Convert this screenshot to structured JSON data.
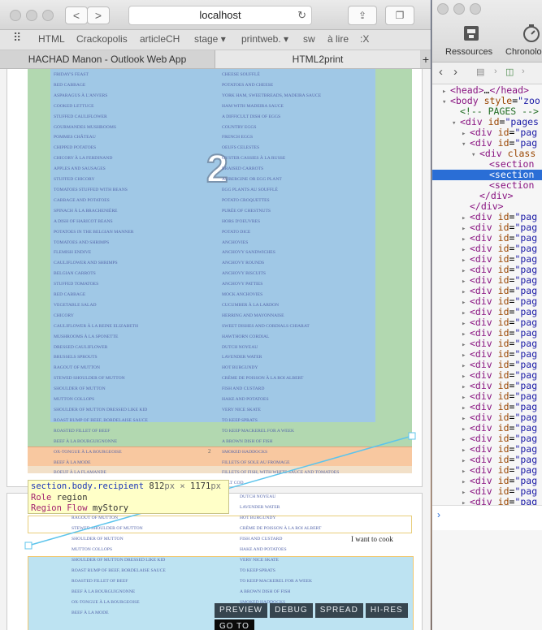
{
  "browser": {
    "url": "localhost",
    "nav": {
      "back": "<",
      "forward": ">"
    },
    "bookmarks": [
      "HTML",
      "Crackopolis",
      "articleCH",
      "stage ▾",
      "printweb. ▾",
      "sw",
      "à lire",
      ":X"
    ],
    "tabs": [
      "HACHAD Manon - Outlook Web App",
      "HTML2print"
    ],
    "new_tab": "+"
  },
  "page1": {
    "big_number": "2",
    "page_number": "2",
    "col1": [
      "Friday's feast",
      "Red cabbage",
      "Asparagus à l'anvers",
      "Cooked lettuce",
      "Stuffed cauliflower",
      "Gourmandes mushrooms",
      "Pommes château",
      "Chipped potatoes",
      "Chicory à la ferdinand",
      "Apples and sausages",
      "Stuffed chicory",
      "Tomatoes stuffed with beans",
      "Cabbage and potatoes",
      "Spinach à la brachenière",
      "A dish of haricot beans",
      "Potatoes in the belgian manner",
      "Tomatoes and shrimps",
      "Flemish endive",
      "Cauliflower and shrimps",
      "Belgian carrots",
      "Stuffed tomatoes",
      "Red cabbage",
      "Vegetable salad",
      "Chicory",
      "Cauliflower à la reine elizabeth",
      "Mushrooms à la sponette",
      "Dressed cauliflower",
      "Brussels sprouts",
      "Ragout of mutton",
      "Stewed shoulder of mutton",
      "Shoulder of mutton",
      "Mutton collops",
      "Shoulder of mutton dressed like kid",
      "Roast rump of beef, bordelaise sauce",
      "Roasted fillet of beef",
      "Beef à la bourguignonne",
      "Ox-tongue à la bourgeoise",
      "Beef à la mode",
      "Boeuf à la flamande"
    ],
    "col2": [
      "Cheese soufflé",
      "Potatoes and cheese",
      "York ham, sweetbreads, madeira sauce",
      "Ham with madeira sauce",
      "A difficult dish of eggs",
      "Country eggs",
      "French eggs",
      "Oeufs celestes",
      "Oyster cassies à la russe",
      "Braised carrots",
      "Aubergine or egg plant",
      "Egg plants au soufflé",
      "Potato croquettes",
      "Purée of chestnuts",
      "Hors d'oeuvres",
      "Potato dice",
      "Anchovies",
      "Anchovy sandwiches",
      "Anchovy rounds",
      "Anchovy biscuits",
      "Anchovy patties",
      "Mock anchovies",
      "Cucumber à la lardon",
      "Herring and mayonnaise",
      "Sweet dishes and cordials chiarat",
      "Hawthorn cordial",
      "Dutch noyeau",
      "Lavender water",
      "Hot burgundy",
      "Crème de poisson à la roi albert",
      "Fish and custard",
      "Hake and potatoes",
      "Very nice skate",
      "To keep sprats",
      "To keep mackerel for a week",
      "A brown dish of fish",
      "Smoked haddocks",
      "Fillets of sole au fromage",
      "Fillets of fish, with white sauce and tomatoes",
      "Salt cod"
    ]
  },
  "page2": {
    "annotation": "I want to cook",
    "col1": [
      "Ragout of mutton",
      "Stewed shoulder of mutton",
      "Shoulder of mutton",
      "Mutton collops",
      "Shoulder of mutton dressed like kid",
      "Roast rump of beef, bordelaise sauce",
      "Roasted fillet of beef",
      "Beef à la bourguignonne",
      "Ox-tongue à la bourgeoise",
      "Beef à la mode"
    ],
    "col2": [
      "Dutch noyeau",
      "Lavender water",
      "Hot burgundy",
      "Crème de poisson à la roi albert",
      "Fish and custard",
      "Hake and potatoes",
      "Very nice skate",
      "To keep sprats",
      "To keep mackerel for a week",
      "A brown dish of fish",
      "Smoked haddocks"
    ]
  },
  "tooltip": {
    "selector": "section.body.recipient",
    "width": "812",
    "height": "1171",
    "unit": "px",
    "times": "×",
    "role_label": "Role",
    "role_value": "region",
    "flow_label": "Region Flow",
    "flow_value": "myStory"
  },
  "view_buttons": [
    "PREVIEW",
    "DEBUG",
    "SPREAD",
    "HI-RES",
    "GO TO"
  ],
  "inspector": {
    "toolbar": [
      "Ressources",
      "Chronolo"
    ],
    "tree": [
      {
        "indent": 2,
        "arrow": "▸",
        "html": "<span class='tag'>&lt;head&gt;</span>…<span class='tag'>&lt;/head&gt;</span>"
      },
      {
        "indent": 2,
        "arrow": "▾",
        "html": "<span class='tag'>&lt;body</span> <span class='attr'>style</span>=<span class='val'>\"zoo</span>"
      },
      {
        "indent": 4,
        "arrow": "",
        "html": "<span class='comment'>&lt;!-- PAGES --&gt;</span>"
      },
      {
        "indent": 4,
        "arrow": "▾",
        "html": "<span class='tag'>&lt;div</span> <span class='attr'>id</span>=<span class='val'>\"pages</span>"
      },
      {
        "indent": 6,
        "arrow": "▸",
        "html": "<span class='tag'>&lt;div</span> <span class='attr'>id</span>=<span class='val'>\"pag</span>"
      },
      {
        "indent": 6,
        "arrow": "▾",
        "html": "<span class='tag'>&lt;div</span> <span class='attr'>id</span>=<span class='val'>\"pag</span>"
      },
      {
        "indent": 8,
        "arrow": "▾",
        "html": "<span class='tag'>&lt;div</span> <span class='attr'>class</span>"
      },
      {
        "indent": 10,
        "arrow": "",
        "html": "<span class='tag'>&lt;section</span>"
      },
      {
        "indent": 10,
        "arrow": "",
        "html": "<span class='tag'>&lt;section</span>",
        "selected": true
      },
      {
        "indent": 10,
        "arrow": "",
        "html": "<span class='tag'>&lt;section</span>"
      },
      {
        "indent": 8,
        "arrow": "",
        "html": "<span class='tag'>&lt;/div&gt;</span>"
      },
      {
        "indent": 6,
        "arrow": "",
        "html": "<span class='tag'>&lt;/div&gt;</span>"
      },
      {
        "indent": 6,
        "arrow": "▸",
        "html": "<span class='tag'>&lt;div</span> <span class='attr'>id</span>=<span class='val'>\"pag</span>",
        "repeat": 28
      }
    ]
  }
}
